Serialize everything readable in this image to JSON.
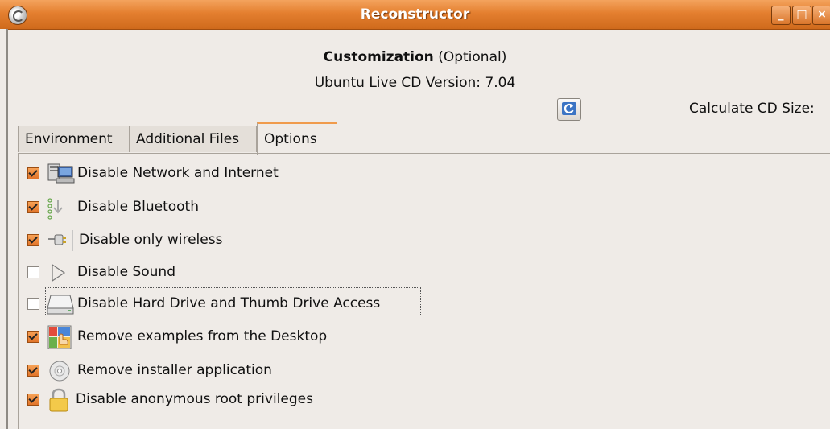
{
  "window": {
    "title": "Reconstructor",
    "controls": [
      "minimize",
      "maximize",
      "close"
    ]
  },
  "header": {
    "customization_bold": "Customization",
    "customization_rest": " (Optional)",
    "version_text": "Ubuntu Live CD Version: 7.04",
    "calculate_label": "Calculate CD Size:"
  },
  "tabs": [
    {
      "label": "Environment",
      "active": false
    },
    {
      "label": "Additional Files",
      "active": false
    },
    {
      "label": "Options",
      "active": true
    }
  ],
  "options": [
    {
      "label": "Disable Network and Internet",
      "checked": true,
      "icon": "network-computer-icon"
    },
    {
      "label": "Disable Bluetooth",
      "checked": true,
      "icon": "bluetooth-icon"
    },
    {
      "label": "Disable only wireless",
      "checked": true,
      "icon": "wireless-plug-icon"
    },
    {
      "label": "Disable Sound",
      "checked": false,
      "icon": "play-triangle-icon"
    },
    {
      "label": "Disable Hard Drive and Thumb Drive Access",
      "checked": false,
      "icon": "hard-drive-icon"
    },
    {
      "label": "Remove examples from the Desktop",
      "checked": true,
      "icon": "examples-folder-icon"
    },
    {
      "label": "Remove installer application",
      "checked": true,
      "icon": "cd-disc-icon"
    },
    {
      "label": "Disable anonymous root privileges",
      "checked": true,
      "icon": "padlock-icon"
    }
  ],
  "colors": {
    "titlebar": "#e47f2f",
    "checkbox_checked": "#e1742a",
    "window_bg": "#efebe7"
  }
}
